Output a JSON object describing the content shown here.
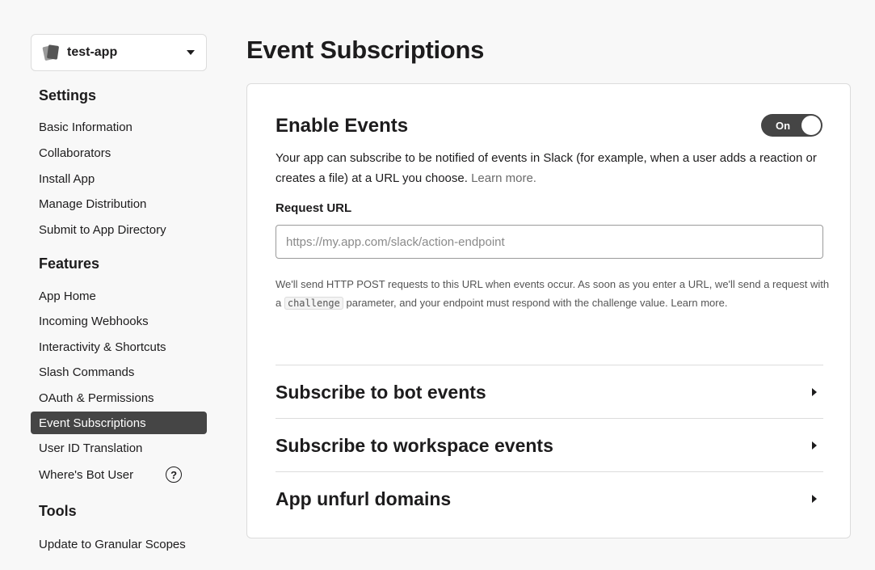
{
  "app_selector": {
    "name": "test-app"
  },
  "sidebar": {
    "settings_heading": "Settings",
    "settings_items": [
      "Basic Information",
      "Collaborators",
      "Install App",
      "Manage Distribution",
      "Submit to App Directory"
    ],
    "features_heading": "Features",
    "features_items": [
      "App Home",
      "Incoming Webhooks",
      "Interactivity & Shortcuts",
      "Slash Commands",
      "OAuth & Permissions",
      "Event Subscriptions",
      "User ID Translation",
      "Where's Bot User"
    ],
    "help_icon_glyph": "?",
    "tools_heading": "Tools",
    "tools_items": [
      "Update to Granular Scopes"
    ],
    "active_item": "Event Subscriptions"
  },
  "main": {
    "page_title": "Event Subscriptions",
    "enable_events": {
      "title": "Enable Events",
      "toggle_label": "On",
      "toggle_state": "on",
      "description": "Your app can subscribe to be notified of events in Slack (for example, when a user adds a reaction or creates a file) at a URL you choose.",
      "learn_more": "Learn more.",
      "request_url_label": "Request URL",
      "request_url_placeholder": "https://my.app.com/slack/action-endpoint",
      "request_url_value": "",
      "help_before_code": "We'll send HTTP POST requests to this URL when events occur. As soon as you enter a URL, we'll send a request with a",
      "help_code": "challenge",
      "help_after_code": "parameter, and your endpoint must respond with the challenge value.",
      "help_learn_more": "Learn more."
    },
    "sections": [
      "Subscribe to bot events",
      "Subscribe to workspace events",
      "App unfurl domains"
    ]
  },
  "colors": {
    "active_nav_bg": "#454545",
    "toggle_bg": "#454545",
    "link_text": "#6b6b6b"
  }
}
